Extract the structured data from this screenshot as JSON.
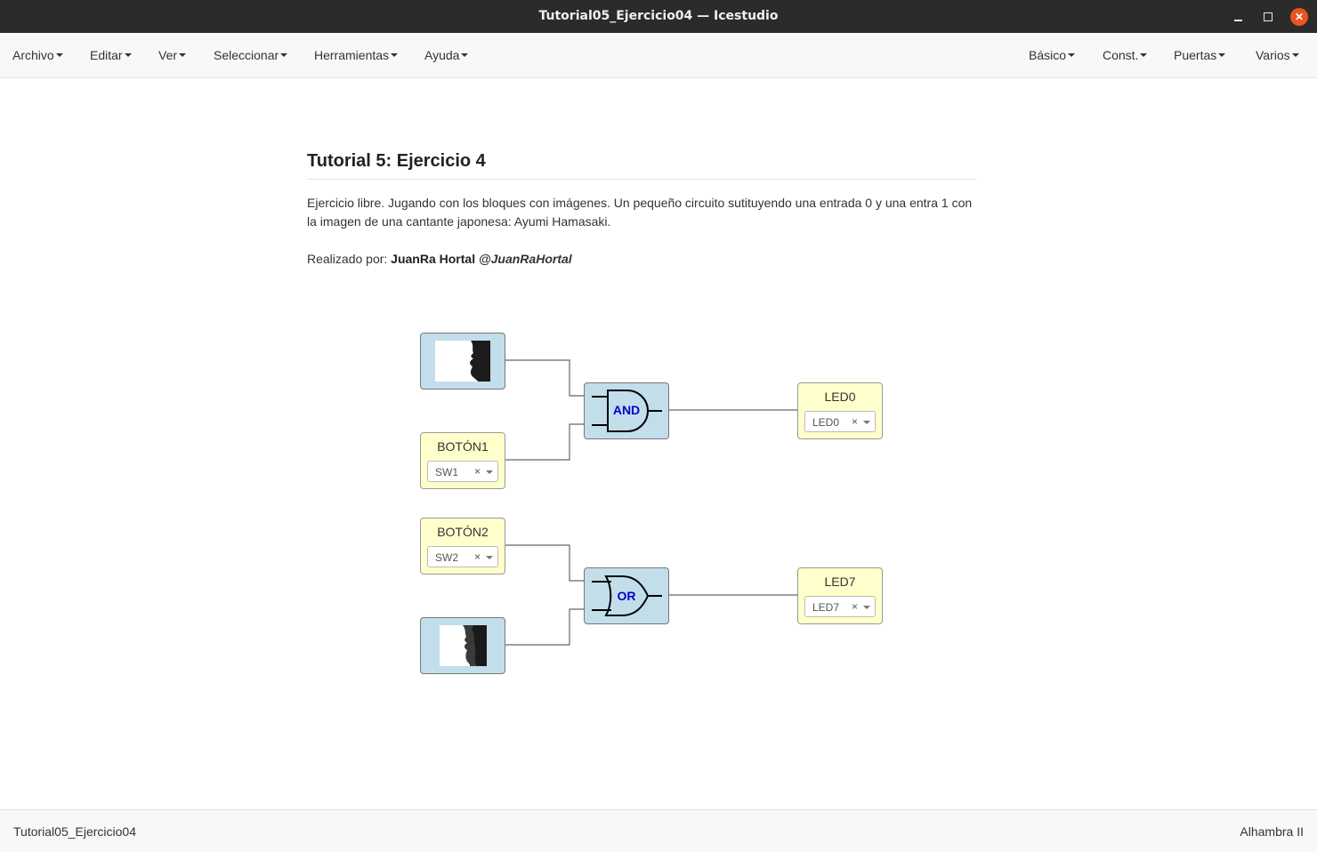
{
  "window": {
    "title": "Tutorial05_Ejercicio04 — Icestudio"
  },
  "menu_left": [
    "Archivo",
    "Editar",
    "Ver",
    "Seleccionar",
    "Herramientas",
    "Ayuda"
  ],
  "menu_right": [
    "Básico",
    "Const.",
    "Puertas",
    "Varios"
  ],
  "doc": {
    "heading": "Tutorial 5: Ejercicio 4",
    "description": "Ejercicio libre. Jugando con los bloques con imágenes. Un pequeño circuito sutituyendo una entrada 0 y una entra 1 con la imagen de una cantante japonesa: Ayumi Hamasaki.",
    "author_prefix": "Realizado por: ",
    "author_name": "JuanRa Hortal",
    "author_handle": "@JuanRaHortal"
  },
  "circuit": {
    "and_gate_label": "AND",
    "or_gate_label": "OR",
    "boton1": {
      "label": "BOTÓN1",
      "pin": "SW1"
    },
    "boton2": {
      "label": "BOTÓN2",
      "pin": "SW2"
    },
    "led0": {
      "label": "LED0",
      "pin": "LED0"
    },
    "led7": {
      "label": "LED7",
      "pin": "LED7"
    },
    "clear_symbol": "×",
    "gate_text_color": "#0000cc"
  },
  "statusbar": {
    "project": "Tutorial05_Ejercicio04",
    "board": "Alhambra II"
  }
}
